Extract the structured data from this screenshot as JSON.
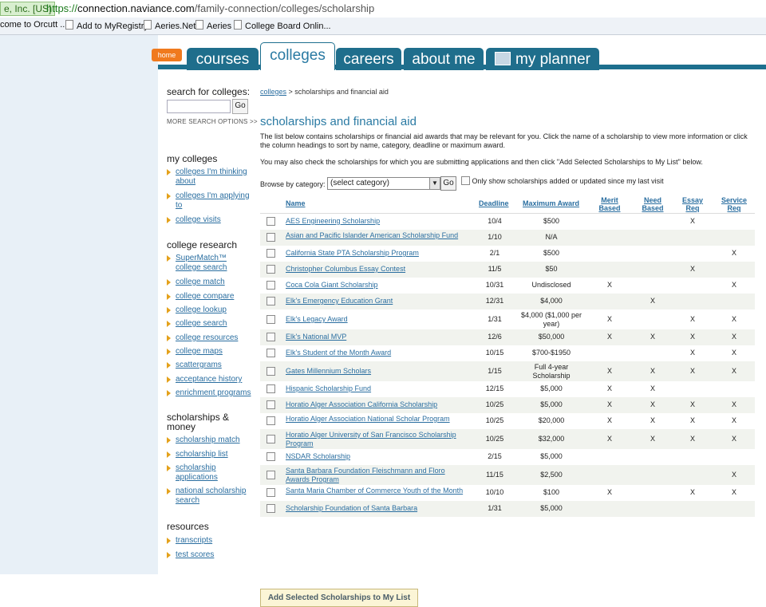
{
  "browser": {
    "site_id": "e, Inc. [US]",
    "url_scheme": "https://",
    "url_host": "connection.naviance.com",
    "url_path": "/family-connection/colleges/scholarship",
    "bookmarks": [
      "come to Orcutt ...",
      "Add to MyRegistry",
      "Aeries.Net",
      "Aeries",
      "College Board Onlin..."
    ]
  },
  "nav": {
    "home": "home",
    "tabs": [
      "courses",
      "colleges",
      "careers",
      "about me",
      "my planner"
    ],
    "active": "colleges"
  },
  "sidebar": {
    "search_label": "search for colleges:",
    "search_go": "Go",
    "more_options": "MORE SEARCH OPTIONS >>",
    "my_colleges_heading": "my colleges",
    "my_colleges": [
      "colleges I'm thinking about",
      "colleges I'm applying to",
      "college visits"
    ],
    "research_heading": "college research",
    "research": [
      "SuperMatch™ college search",
      "college match",
      "college compare",
      "college lookup",
      "college search",
      "college resources",
      "college maps",
      "scattergrams",
      "acceptance history",
      "enrichment programs"
    ],
    "money_heading": "scholarships & money",
    "money": [
      "scholarship match",
      "scholarship list",
      "scholarship applications",
      "national scholarship search"
    ],
    "resources_heading": "resources",
    "resources": [
      "transcripts",
      "test scores"
    ]
  },
  "main": {
    "breadcrumb_link": "colleges",
    "breadcrumb_rest": " > scholarships and financial aid",
    "title": "scholarships and financial aid",
    "intro1": "The list below contains scholarships or financial aid awards that may be relevant for you. Click the name of a scholarship to view more information or click the column headings to sort by name, category, deadline or maximum award.",
    "intro2": "You may also check the scholarships for which you are submitting applications and then click \"Add Selected Scholarships to My List\" below.",
    "browse_label": "Browse by category:",
    "category_value": "(select category)",
    "category_go": "Go",
    "only_show": "Only show scholarships added or updated since my last visit",
    "add_button": "Add Selected Scholarships to My List"
  },
  "table": {
    "headers": {
      "name": "Name",
      "deadline": "Deadline",
      "award": "Maximum Award",
      "merit": "Merit Based",
      "need": "Need Based",
      "essay": "Essay Req",
      "service": "Service Req"
    },
    "rows": [
      {
        "name": "AES Engineering Scholarship",
        "deadline": "10/4",
        "award": "$500",
        "merit": "",
        "need": "",
        "essay": "X",
        "service": ""
      },
      {
        "name": "Asian and Pacific Islander American Scholarship Fund",
        "deadline": "1/10",
        "award": "N/A",
        "merit": "",
        "need": "",
        "essay": "",
        "service": ""
      },
      {
        "name": "California State PTA Scholarship Program",
        "deadline": "2/1",
        "award": "$500",
        "merit": "",
        "need": "",
        "essay": "",
        "service": "X"
      },
      {
        "name": "Christopher Columbus Essay Contest",
        "deadline": "11/5",
        "award": "$50",
        "merit": "",
        "need": "",
        "essay": "X",
        "service": ""
      },
      {
        "name": "Coca Cola Giant Scholarship",
        "deadline": "10/31",
        "award": "Undisclosed",
        "merit": "X",
        "need": "",
        "essay": "",
        "service": "X"
      },
      {
        "name": "Elk's Emergency Education Grant",
        "deadline": "12/31",
        "award": "$4,000",
        "merit": "",
        "need": "X",
        "essay": "",
        "service": ""
      },
      {
        "name": "Elk's Legacy Award",
        "deadline": "1/31",
        "award": "$4,000 ($1,000 per year)",
        "merit": "X",
        "need": "",
        "essay": "X",
        "service": "X"
      },
      {
        "name": "Elk's National MVP",
        "deadline": "12/6",
        "award": "$50,000",
        "merit": "X",
        "need": "X",
        "essay": "X",
        "service": "X"
      },
      {
        "name": "Elk's Student of the Month Award",
        "deadline": "10/15",
        "award": "$700-$1950",
        "merit": "",
        "need": "",
        "essay": "X",
        "service": "X"
      },
      {
        "name": "Gates Millennium Scholars",
        "deadline": "1/15",
        "award": "Full 4-year Scholarship",
        "merit": "X",
        "need": "X",
        "essay": "X",
        "service": "X"
      },
      {
        "name": "Hispanic Scholarship Fund",
        "deadline": "12/15",
        "award": "$5,000",
        "merit": "X",
        "need": "X",
        "essay": "",
        "service": ""
      },
      {
        "name": "Horatio Alger Association California Scholarship",
        "deadline": "10/25",
        "award": "$5,000",
        "merit": "X",
        "need": "X",
        "essay": "X",
        "service": "X"
      },
      {
        "name": "Horatio Alger Association National Scholar Program",
        "deadline": "10/25",
        "award": "$20,000",
        "merit": "X",
        "need": "X",
        "essay": "X",
        "service": "X"
      },
      {
        "name": "Horatio Alger University of San Francisco Scholarship Program",
        "deadline": "10/25",
        "award": "$32,000",
        "merit": "X",
        "need": "X",
        "essay": "X",
        "service": "X"
      },
      {
        "name": "NSDAR Scholarship",
        "deadline": "2/15",
        "award": "$5,000",
        "merit": "",
        "need": "",
        "essay": "",
        "service": ""
      },
      {
        "name": "Santa Barbara Foundation Fleischmann and Floro Awards Program",
        "deadline": "11/15",
        "award": "$2,500",
        "merit": "",
        "need": "",
        "essay": "",
        "service": "X"
      },
      {
        "name": "Santa Maria Chamber of Commerce Youth of the Month",
        "deadline": "10/10",
        "award": "$100",
        "merit": "X",
        "need": "",
        "essay": "X",
        "service": "X"
      },
      {
        "name": "Scholarship Foundation of Santa Barbara",
        "deadline": "1/31",
        "award": "$5,000",
        "merit": "",
        "need": "",
        "essay": "",
        "service": ""
      }
    ]
  }
}
